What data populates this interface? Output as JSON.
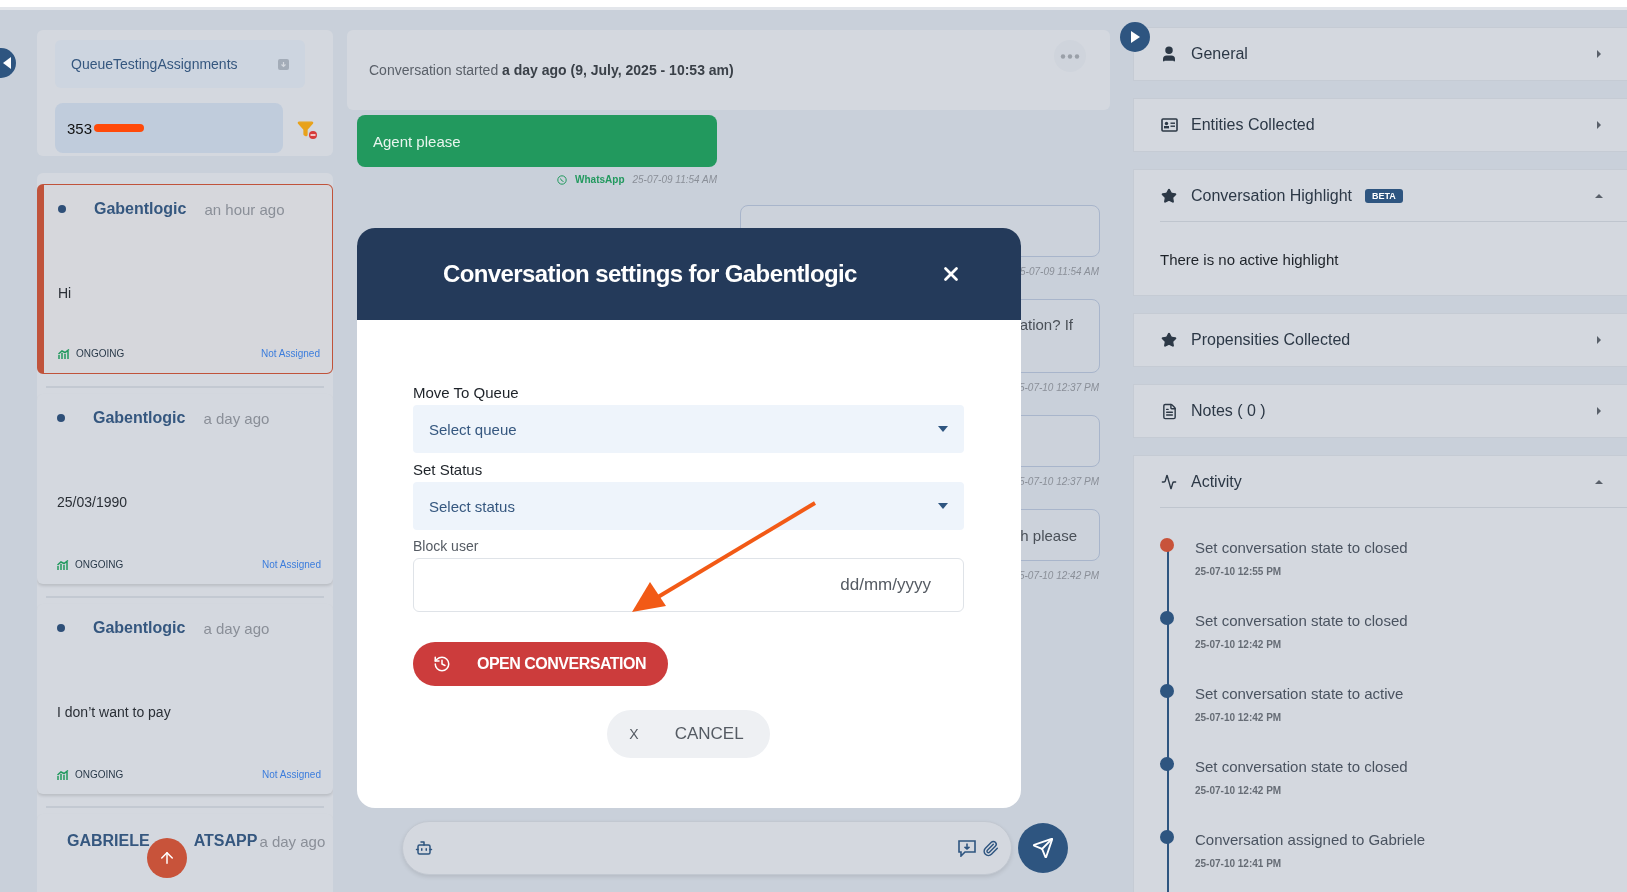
{
  "left_panel": {
    "queue_select": {
      "value": "QueueTestingAssignments"
    },
    "phone_search": {
      "value": "353"
    }
  },
  "conversations": [
    {
      "kind": "contact",
      "name": "Gabentlogic",
      "time": "an hour ago",
      "message": "Hi",
      "status": "ONGOING",
      "assignee": "Not Assigned",
      "selected": true
    },
    {
      "kind": "contact",
      "name": "Gabentlogic",
      "time": "a day ago",
      "message": "25/03/1990",
      "status": "ONGOING",
      "assignee": "Not Assigned",
      "selected": false
    },
    {
      "kind": "contact",
      "name": "Gabentlogic",
      "time": "a day ago",
      "message": "I don’t want to pay",
      "status": "ONGOING",
      "assignee": "Not Assigned",
      "selected": false
    },
    {
      "kind": "bot",
      "name": "GABRIELE",
      "name_continued": "ATSAPP",
      "time": "a day ago",
      "selected": false
    }
  ],
  "chat": {
    "header": "Conversation started **a day ago (9, July, 2025 - 10:53 am)**",
    "messages": [
      {
        "kind": "incoming",
        "text": "Agent please",
        "channel": "WhatsApp",
        "time": "25-07-09 11:54 AM"
      },
      {
        "kind": "outgoing",
        "time": "5-07-09 11:54 AM"
      },
      {
        "kind": "outgoing",
        "text": "ation? If",
        "time": "5-07-10 12:37 PM"
      },
      {
        "kind": "outgoing",
        "time": "5-07-10 12:37 PM"
      },
      {
        "kind": "outgoing",
        "text": "h please",
        "time": "5-07-10 12:42 PM"
      }
    ]
  },
  "modal": {
    "title": "Conversation settings for Gabentlogic",
    "fields": [
      {
        "kind": "select",
        "label": "Move To Queue",
        "placeholder": "Select queue"
      },
      {
        "kind": "select",
        "label": "Set Status",
        "placeholder": "Select status"
      },
      {
        "kind": "date",
        "label": "Block user",
        "placeholder": "dd/mm/yyyy"
      }
    ],
    "primary_button": "OPEN CONVERSATION",
    "cancel_button": {
      "icon": "X",
      "label": "CANCEL"
    }
  },
  "details": {
    "sections": [
      {
        "kind": "general",
        "title": "General",
        "expanded": false
      },
      {
        "kind": "entities",
        "title": "Entities Collected",
        "expanded": false
      },
      {
        "kind": "highlight",
        "title": "Conversation Highlight",
        "badge": "BETA",
        "expanded": true,
        "body": "There is no active highlight"
      },
      {
        "kind": "propensities",
        "title": "Propensities Collected",
        "expanded": false
      },
      {
        "kind": "notes",
        "title": "Notes ( 0 )",
        "expanded": false
      },
      {
        "kind": "activity",
        "title": "Activity",
        "expanded": true,
        "events": [
          {
            "text": "Set conversation state to closed",
            "time": "25-07-10 12:55 PM",
            "color": "#c8533a"
          },
          {
            "text": "Set conversation state to closed",
            "time": "25-07-10 12:42 PM",
            "color": "#2e5580"
          },
          {
            "text": "Set conversation state to active",
            "time": "25-07-10 12:42 PM",
            "color": "#2e5580"
          },
          {
            "text": "Set conversation state to closed",
            "time": "25-07-10 12:42 PM",
            "color": "#2e5580"
          },
          {
            "text": "Conversation assigned to Gabriele",
            "time": "25-07-10 12:41 PM",
            "color": "#2e5580"
          }
        ]
      }
    ]
  }
}
